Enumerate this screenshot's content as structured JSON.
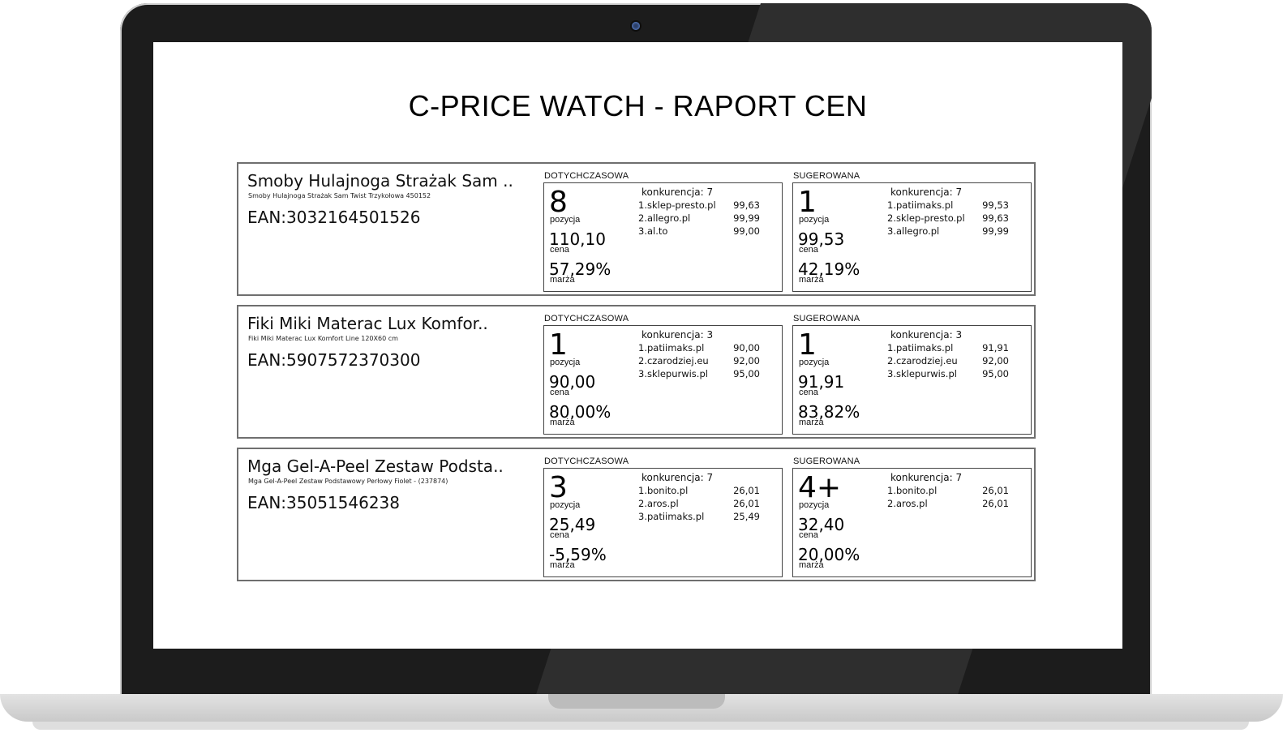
{
  "report": {
    "title": "C-PRICE WATCH - RAPORT CEN"
  },
  "labels": {
    "current": "DOTYCHCZASOWA",
    "suggested": "SUGEROWANA",
    "position": "pozycja",
    "price": "cena",
    "margin": "marża"
  },
  "products": [
    {
      "name": "Smoby Hulajnoga Strażak Sam ..",
      "full_name": "Smoby Hulajnoga Strażak Sam Twist Trzykołowa 450152",
      "ean": "EAN:3032164501526",
      "current": {
        "position": "8",
        "price": "110,10",
        "margin": "57,29%",
        "competition": "konkurencja: 7",
        "competitors": [
          {
            "shop": "1.sklep-presto.pl",
            "price": "99,63"
          },
          {
            "shop": "2.allegro.pl",
            "price": "99,99"
          },
          {
            "shop": "3.al.to",
            "price": "99,00"
          }
        ]
      },
      "suggested": {
        "position": "1",
        "price": "99,53",
        "margin": "42,19%",
        "competition": "konkurencja: 7",
        "competitors": [
          {
            "shop": "1.patiimaks.pl",
            "price": "99,53"
          },
          {
            "shop": "2.sklep-presto.pl",
            "price": "99,63"
          },
          {
            "shop": "3.allegro.pl",
            "price": "99,99"
          }
        ]
      }
    },
    {
      "name": "Fiki Miki Materac Lux Komfor..",
      "full_name": "Fiki Miki Materac Lux Komfort Line 120X60 cm",
      "ean": "EAN:5907572370300",
      "current": {
        "position": "1",
        "price": "90,00",
        "margin": "80,00%",
        "competition": "konkurencja: 3",
        "competitors": [
          {
            "shop": "1.patiimaks.pl",
            "price": "90,00"
          },
          {
            "shop": "2.czarodziej.eu",
            "price": "92,00"
          },
          {
            "shop": "3.sklepurwis.pl",
            "price": "95,00"
          }
        ]
      },
      "suggested": {
        "position": "1",
        "price": "91,91",
        "margin": "83,82%",
        "competition": "konkurencja: 3",
        "competitors": [
          {
            "shop": "1.patiimaks.pl",
            "price": "91,91"
          },
          {
            "shop": "2.czarodziej.eu",
            "price": "92,00"
          },
          {
            "shop": "3.sklepurwis.pl",
            "price": "95,00"
          }
        ]
      }
    },
    {
      "name": "Mga Gel-A-Peel Zestaw Podsta..",
      "full_name": "Mga Gel-A-Peel Zestaw Podstawowy Perłowy Fiolet - (237874)",
      "ean": "EAN:35051546238",
      "current": {
        "position": "3",
        "price": "25,49",
        "margin": "-5,59%",
        "competition": "konkurencja: 7",
        "competitors": [
          {
            "shop": "1.bonito.pl",
            "price": "26,01"
          },
          {
            "shop": "2.aros.pl",
            "price": "26,01"
          },
          {
            "shop": "3.patiimaks.pl",
            "price": "25,49"
          }
        ]
      },
      "suggested": {
        "position": "4+",
        "price": "32,40",
        "margin": "20,00%",
        "competition": "konkurencja: 7",
        "competitors": [
          {
            "shop": "1.bonito.pl",
            "price": "26,01"
          },
          {
            "shop": "2.aros.pl",
            "price": "26,01"
          }
        ]
      }
    }
  ]
}
